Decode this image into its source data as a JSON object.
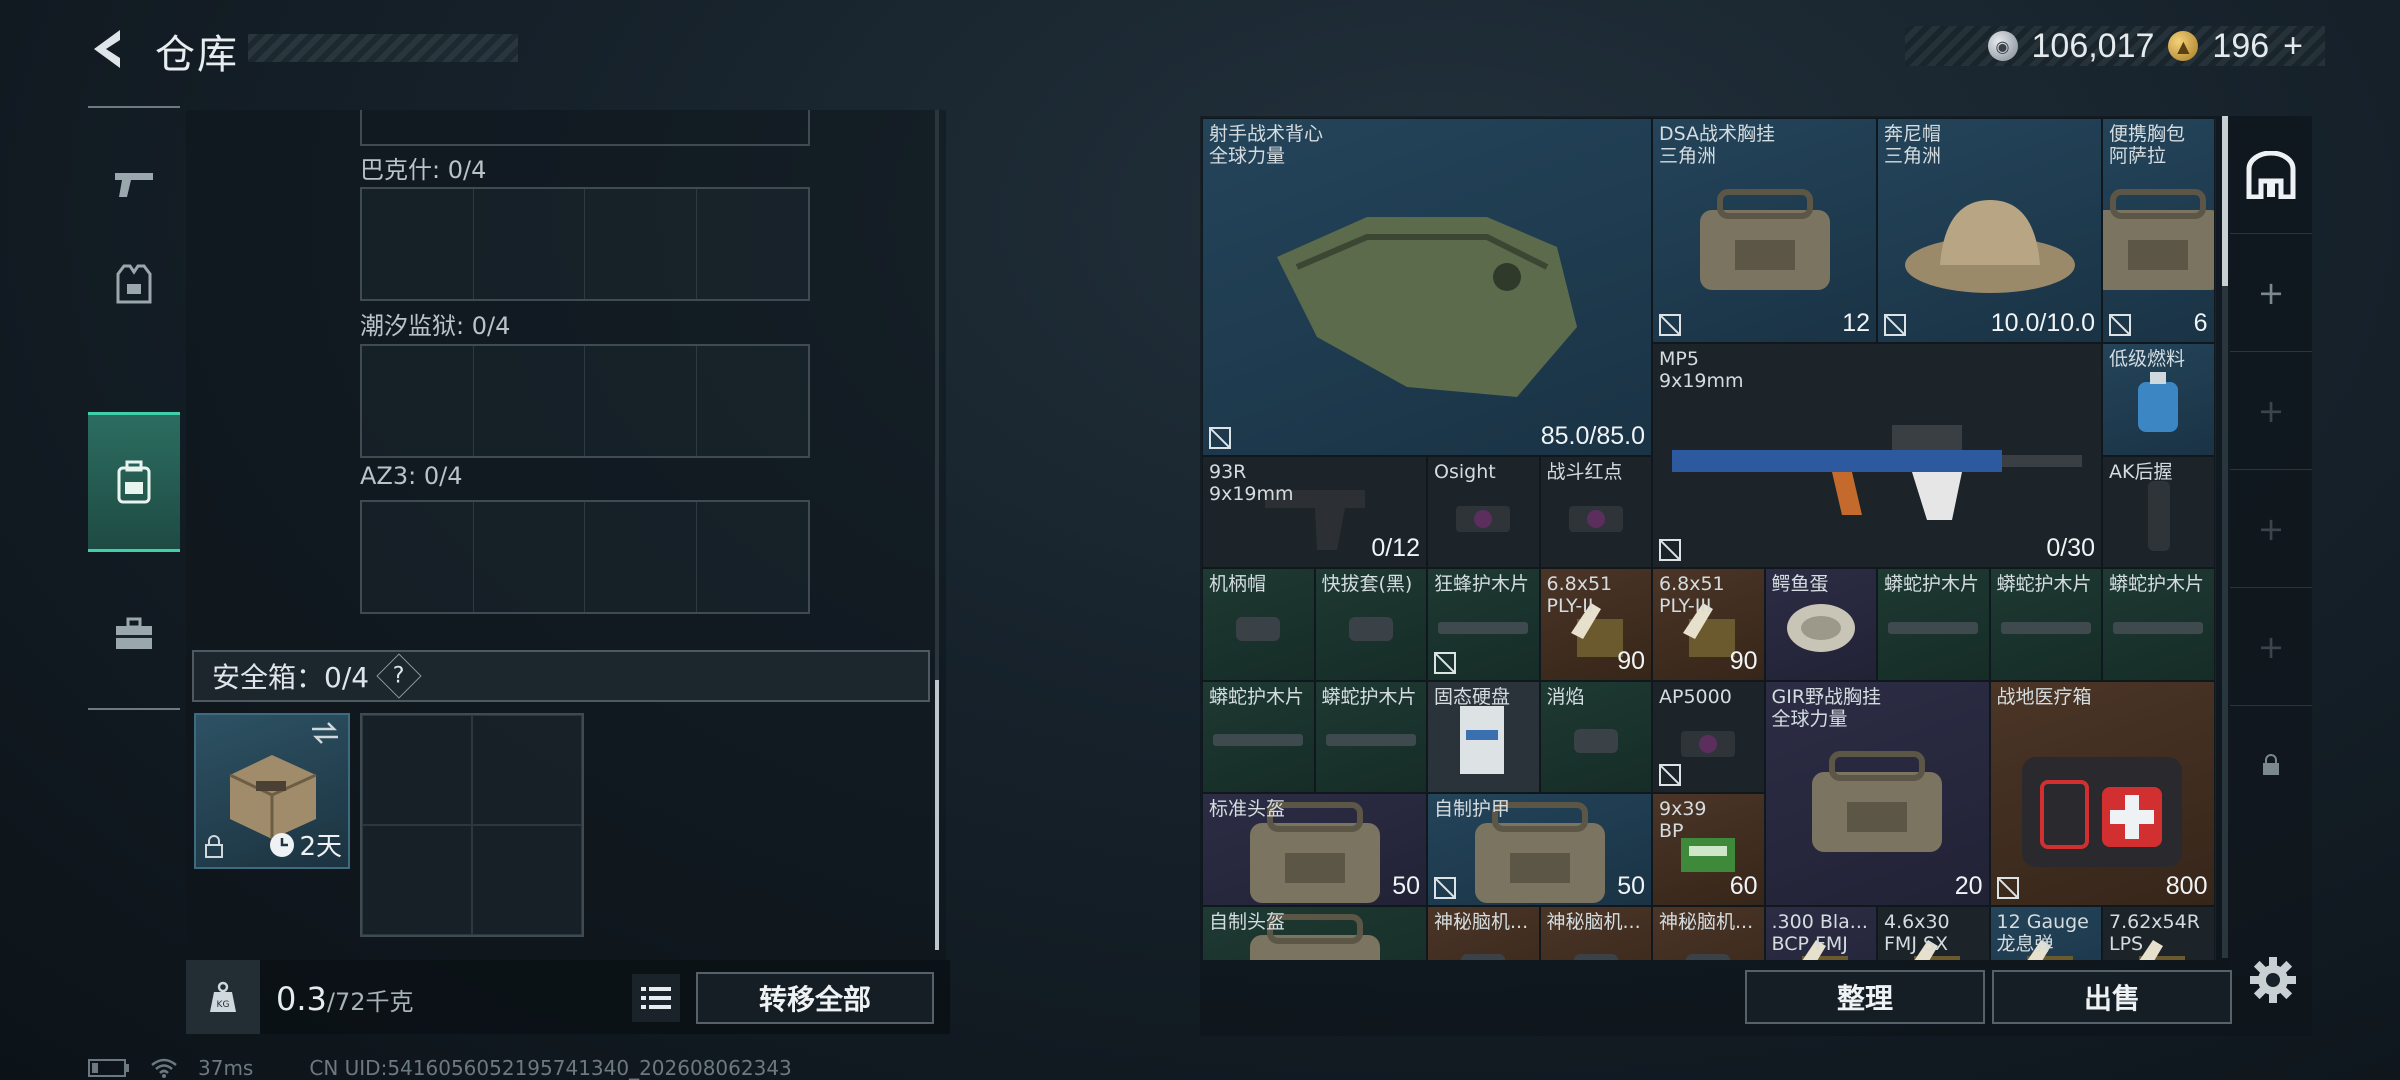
{
  "header": {
    "title": "仓库"
  },
  "currency": {
    "silver": "106,017",
    "gold": "196",
    "add": "+"
  },
  "stash": {
    "slots": [
      {
        "label": "巴克什: 0/4"
      },
      {
        "label": "潮汐监狱: 0/4"
      },
      {
        "label": "AZ3: 0/4"
      }
    ],
    "safebox": {
      "label": "安全箱：0/4",
      "help": "?",
      "timer": "2天"
    }
  },
  "weight": {
    "current": "0.3",
    "max": "/72千克"
  },
  "buttons": {
    "transfer_all": "转移全部",
    "sort": "整理",
    "sell": "出售"
  },
  "status": {
    "ping": "37ms",
    "uid": "CN UID:5416056052195741340_202608062343"
  },
  "items": [
    {
      "name": "射手战术背心\n全球力量",
      "value": "85.0/85.0",
      "noins": true
    },
    {
      "name": "DSA战术胸挂\n三角洲",
      "value": "12",
      "noins": true
    },
    {
      "name": "奔尼帽\n三角洲",
      "value": "10.0/10.0",
      "noins": true
    },
    {
      "name": "便携胸包\n阿萨拉",
      "value": "6",
      "noins": true
    },
    {
      "name": "MP5\n9x19mm",
      "value": "0/30",
      "noins": true
    },
    {
      "name": "低级燃料",
      "value": ""
    },
    {
      "name": "93R\n9x19mm",
      "value": "0/12"
    },
    {
      "name": "Osight",
      "value": ""
    },
    {
      "name": "战斗红点",
      "value": ""
    },
    {
      "name": "AK后握",
      "value": ""
    },
    {
      "name": "机柄帽",
      "value": ""
    },
    {
      "name": "快拔套(黑)",
      "value": ""
    },
    {
      "name": "狂蜂护木片",
      "value": "",
      "noins": true
    },
    {
      "name": "6.8x51\nPLY-II",
      "value": "90"
    },
    {
      "name": "6.8x51\nPLY-III",
      "value": "90"
    },
    {
      "name": "鳄鱼蛋",
      "value": ""
    },
    {
      "name": "蟒蛇护木片",
      "value": ""
    },
    {
      "name": "蟒蛇护木片",
      "value": ""
    },
    {
      "name": "蟒蛇护木片",
      "value": ""
    },
    {
      "name": "蟒蛇护木片",
      "value": ""
    },
    {
      "name": "蟒蛇护木片",
      "value": ""
    },
    {
      "name": "固态硬盘",
      "value": ""
    },
    {
      "name": "消焰",
      "value": ""
    },
    {
      "name": "AP5000",
      "value": "",
      "noins": true
    },
    {
      "name": "GIR野战胸挂\n全球力量",
      "value": "20"
    },
    {
      "name": "战地医疗箱",
      "value": "800",
      "noins": true
    },
    {
      "name": "标准头盔",
      "value": "50"
    },
    {
      "name": "自制护甲",
      "value": "50",
      "noins": true
    },
    {
      "name": "9x39\nBP",
      "value": "60"
    },
    {
      "name": "自制头盔",
      "value": ""
    },
    {
      "name": "神秘脑机...",
      "value": ""
    },
    {
      "name": "神秘脑机...",
      "value": ""
    },
    {
      "name": "神秘脑机...",
      "value": ""
    },
    {
      "name": ".300 Bla...\nBCP FMJ",
      "value": ""
    },
    {
      "name": "4.6x30\nFMJ SX",
      "value": ""
    },
    {
      "name": "12 Gauge\n龙息弹",
      "value": ""
    },
    {
      "name": "7.62x54R\nLPS",
      "value": ""
    }
  ],
  "colors": {
    "accent": "#3fd0aa",
    "panel": "#1a2328"
  }
}
